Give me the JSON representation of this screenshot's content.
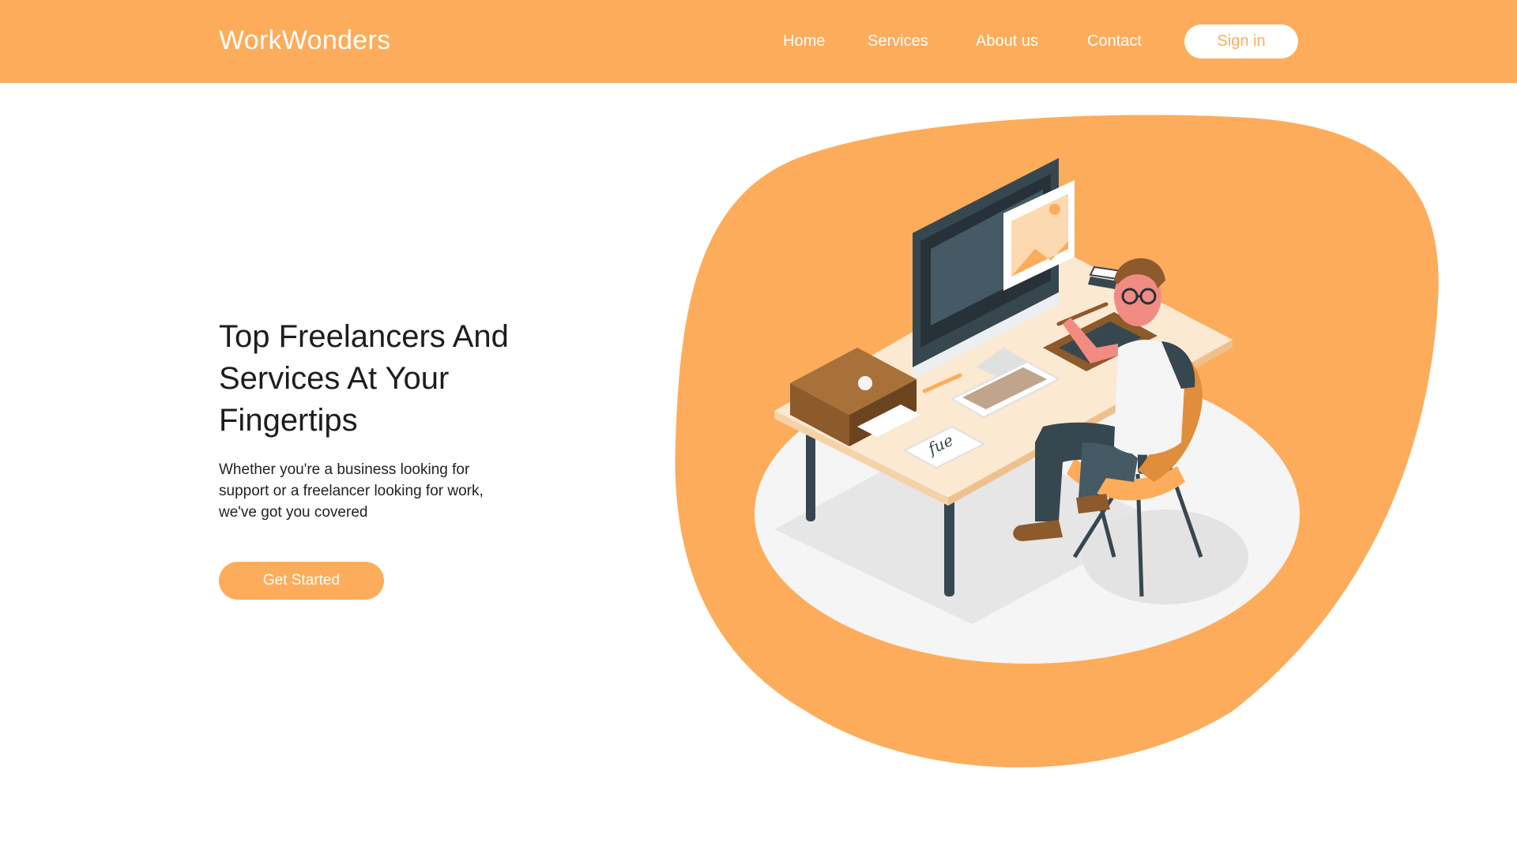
{
  "header": {
    "brand": "WorkWonders",
    "nav": {
      "home": "Home",
      "services": "Services",
      "about": "About us",
      "contact": "Contact"
    },
    "signin_label": "Sign in"
  },
  "hero": {
    "title_line1": "Top Freelancers And",
    "title_line2": "Services At Your",
    "title_line3": "Fingertips",
    "subtitle_line1": "Whether you're a business looking for",
    "subtitle_line2": "support or a freelancer looking for work,",
    "subtitle_line3": "we've got you covered",
    "cta_label": "Get Started"
  },
  "illustration": {
    "signature_text": "fue"
  },
  "colors": {
    "accent": "#FDAC5B",
    "background": "#ffffff",
    "text": "#1d1d1d"
  }
}
